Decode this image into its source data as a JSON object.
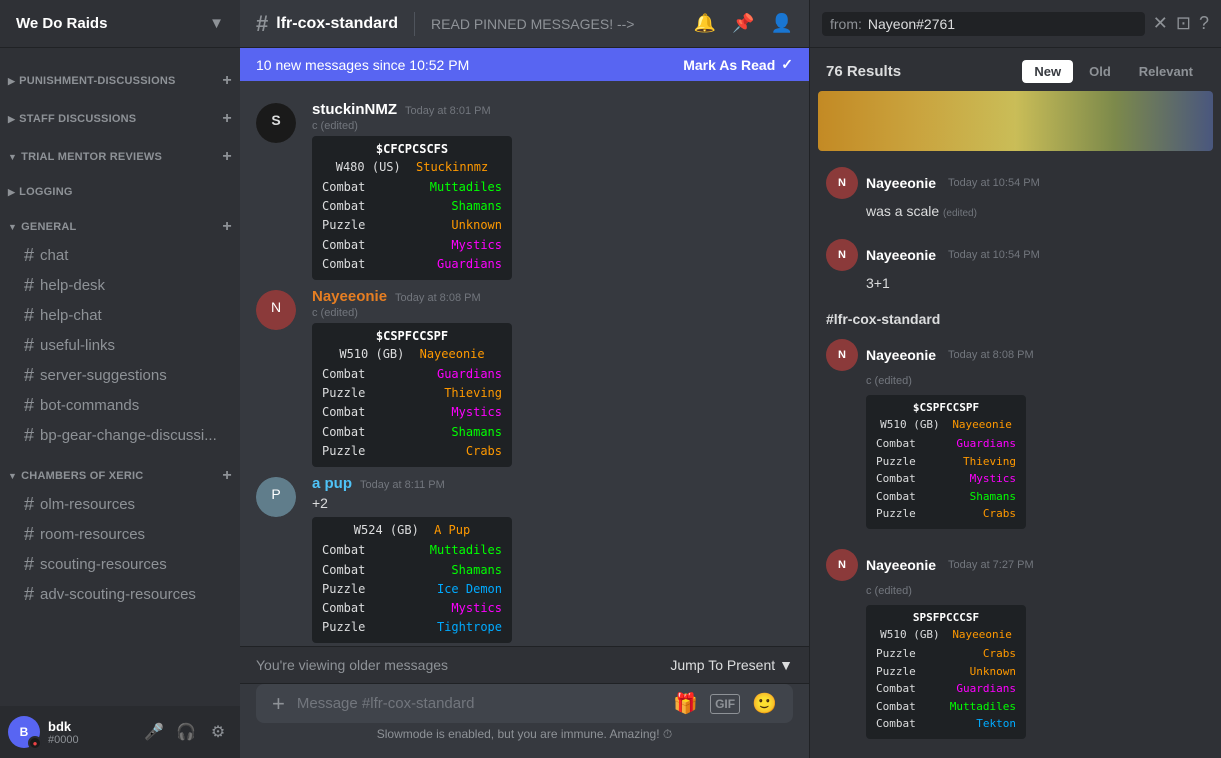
{
  "server": {
    "name": "We Do Raids",
    "icon": "⚔"
  },
  "sidebar": {
    "categories": [
      {
        "id": "punishment-discussions",
        "label": "PUNISHMENT-DISCUSSIONS",
        "collapsed": false,
        "channels": []
      },
      {
        "id": "staff-discussions",
        "label": "STAFF DISCUSSIONS",
        "collapsed": false,
        "channels": []
      },
      {
        "id": "trial-mentor-reviews",
        "label": "TRIAL MENTOR REVIEWS",
        "collapsed": false,
        "channels": []
      },
      {
        "id": "logging",
        "label": "LOGGING",
        "collapsed": false,
        "channels": []
      },
      {
        "id": "general",
        "label": "GENERAL",
        "collapsed": false,
        "channels": [
          {
            "id": "chat",
            "name": "chat"
          },
          {
            "id": "help-desk",
            "name": "help-desk"
          },
          {
            "id": "help-chat",
            "name": "help-chat"
          },
          {
            "id": "useful-links",
            "name": "useful-links"
          },
          {
            "id": "server-suggestions",
            "name": "server-suggestions"
          },
          {
            "id": "bot-commands",
            "name": "bot-commands"
          },
          {
            "id": "bp-gear-change-discussi",
            "name": "bp-gear-change-discussi..."
          }
        ]
      },
      {
        "id": "chambers-of-xeric",
        "label": "CHAMBERS OF XERIC",
        "collapsed": false,
        "channels": [
          {
            "id": "olm-resources",
            "name": "olm-resources"
          },
          {
            "id": "room-resources",
            "name": "room-resources"
          },
          {
            "id": "scouting-resources",
            "name": "scouting-resources"
          },
          {
            "id": "adv-scouting-resources",
            "name": "adv-scouting-resources"
          }
        ]
      }
    ]
  },
  "channel": {
    "name": "lfr-cox-standard",
    "topic": "READ PINNED MESSAGES! -->"
  },
  "notification_bar": {
    "text": "10 new messages since 10:52 PM",
    "action": "Mark As Read"
  },
  "messages": [
    {
      "id": "msg1",
      "author": "stuckinNMZ",
      "time": "Today at 8:01 PM",
      "edited": true,
      "avatar_color": "#1a1a1a",
      "avatar_letter": "S",
      "text": "",
      "card": {
        "header": "$CFCPCSCFS",
        "subheader": "W480 (US)  Stuckinnmz",
        "rows": [
          {
            "label": "Combat",
            "value": "Muttadiles",
            "color": "muttadiles"
          },
          {
            "label": "Combat",
            "value": "Shamans",
            "color": "shamans"
          },
          {
            "label": "Puzzle",
            "value": "Unknown",
            "color": "unknown"
          },
          {
            "label": "Combat",
            "value": "Mystics",
            "color": "mystics"
          },
          {
            "label": "Combat",
            "value": "Guardians",
            "color": "guardians"
          }
        ]
      }
    },
    {
      "id": "msg2",
      "author": "Nayeeonie",
      "time": "Today at 8:08 PM",
      "edited": true,
      "avatar_color": "#c0392b",
      "avatar_letter": "N",
      "text": "",
      "card": {
        "header": "$CSPFCCSPF",
        "subheader": "W510 (GB)  Nayeeonie",
        "rows": [
          {
            "label": "Combat",
            "value": "Guardians",
            "color": "guardians"
          },
          {
            "label": "Puzzle",
            "value": "Thieving",
            "color": "thieving"
          },
          {
            "label": "Combat",
            "value": "Mystics",
            "color": "mystics"
          },
          {
            "label": "Combat",
            "value": "Shamans",
            "color": "shamans"
          },
          {
            "label": "Puzzle",
            "value": "Crabs",
            "color": "crabs"
          }
        ]
      }
    },
    {
      "id": "msg3",
      "author": "a pup",
      "time": "Today at 8:11 PM",
      "edited": false,
      "avatar_color": "#4a90d9",
      "avatar_letter": "P",
      "text": "+2",
      "card": {
        "header": "",
        "subheader": "W524 (GB)     A Pup",
        "rows": [
          {
            "label": "Combat",
            "value": "Muttadiles",
            "color": "muttadiles"
          },
          {
            "label": "Combat",
            "value": "Shamans",
            "color": "shamans"
          },
          {
            "label": "Puzzle",
            "value": "Ice Demon",
            "color": "ice-demon"
          },
          {
            "label": "Combat",
            "value": "Mystics",
            "color": "mystics"
          },
          {
            "label": "Puzzle",
            "value": "Tightrope",
            "color": "tightrope"
          }
        ]
      }
    }
  ],
  "older_messages_bar": {
    "text": "You're viewing older messages",
    "action": "Jump To Present"
  },
  "chat_input": {
    "placeholder": "Message #lfr-cox-standard"
  },
  "slowmode": {
    "text": "Slowmode is enabled, but you are immune. Amazing! ⏱"
  },
  "search": {
    "label": "from:",
    "value": "Nayeon#2761",
    "results_count": "76 Results",
    "tabs": [
      "New",
      "Old",
      "Relevant"
    ],
    "active_tab": "New",
    "channel_label": "#lfr-cox-standard",
    "results": [
      {
        "id": "r1",
        "author": "Nayeeonie",
        "time": "Today at 10:54 PM",
        "edited": true,
        "text": "was a scale",
        "avatar_color": "#c0392b"
      },
      {
        "id": "r2",
        "author": "Nayeeonie",
        "time": "Today at 10:54 PM",
        "edited": false,
        "text": "3+1",
        "avatar_color": "#c0392b"
      },
      {
        "id": "r3",
        "author": "Nayeeonie",
        "time": "Today at 8:08 PM",
        "edited": true,
        "text": "",
        "avatar_color": "#c0392b",
        "card": {
          "header": "$CSPFCCSPF",
          "subheader_world": "W510 (GB)",
          "subheader_name": "Nayeeonie",
          "rows": [
            {
              "label": "Combat",
              "value": "Guardians"
            },
            {
              "label": "Puzzle",
              "value": "Thieving"
            },
            {
              "label": "Combat",
              "value": "Mystics"
            },
            {
              "label": "Combat",
              "value": "Shamans"
            },
            {
              "label": "Puzzle",
              "value": "Crabs"
            }
          ]
        }
      },
      {
        "id": "r4",
        "author": "Nayeeonie",
        "time": "Today at 7:27 PM",
        "edited": true,
        "text": "",
        "avatar_color": "#c0392b",
        "card": {
          "header": "SPSFPCCCSF",
          "subheader_world": "W510 (GB)",
          "subheader_name": "Nayeeonie",
          "rows": [
            {
              "label": "Puzzle",
              "value": "Crabs"
            },
            {
              "label": "Puzzle",
              "value": "Unknown"
            },
            {
              "label": "Combat",
              "value": "Guardians"
            },
            {
              "label": "Combat",
              "value": "Muttadiles"
            },
            {
              "label": "Combat",
              "value": "Tekton"
            }
          ]
        }
      }
    ]
  },
  "user": {
    "name": "bdk",
    "tag": "#0000",
    "avatar_color": "#5865f2",
    "avatar_letter": "B"
  }
}
